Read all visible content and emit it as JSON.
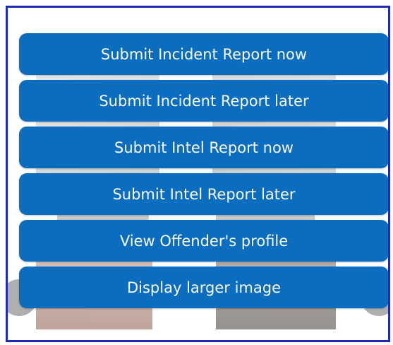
{
  "menu": {
    "items": [
      {
        "label": "Submit Incident Report now"
      },
      {
        "label": "Submit Incident Report later"
      },
      {
        "label": "Submit Intel Report now"
      },
      {
        "label": "Submit Intel Report later"
      },
      {
        "label": "View Offender's profile"
      },
      {
        "label": "Display larger image"
      }
    ]
  },
  "colors": {
    "menu_button": "#0a6dc0",
    "frame_border": "#1f2bb0",
    "button_text": "#ffffff"
  }
}
